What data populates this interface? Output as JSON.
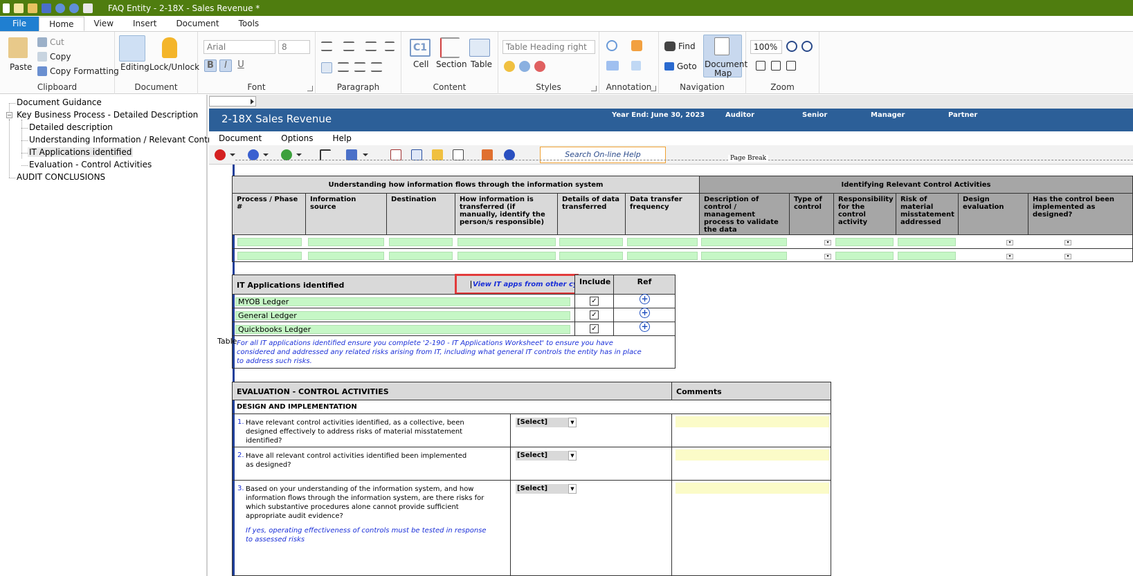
{
  "window": {
    "title": "FAQ Entity - 2-18X - Sales Revenue *"
  },
  "menu": {
    "file": "File",
    "tabs": [
      "Home",
      "View",
      "Insert",
      "Document",
      "Tools"
    ]
  },
  "ribbon": {
    "clipboard": {
      "paste": "Paste",
      "cut": "Cut",
      "copy": "Copy",
      "copy_formatting": "Copy Formatting",
      "label": "Clipboard"
    },
    "document": {
      "editing": "Editing",
      "lock": "Lock/Unlock",
      "label": "Document"
    },
    "font": {
      "name": "Arial",
      "size": "8",
      "label": "Font"
    },
    "paragraph": {
      "label": "Paragraph"
    },
    "content": {
      "cell": "Cell",
      "section": "Section",
      "table": "Table",
      "label": "Content"
    },
    "styles": {
      "current": "Table Heading right",
      "label": "Styles"
    },
    "annotation": {
      "label": "Annotation"
    },
    "navigation": {
      "find": "Find",
      "goto": "Goto",
      "docmap_line1": "Document",
      "docmap_line2": "Map",
      "label": "Navigation"
    },
    "zoom": {
      "level": "100%",
      "label": "Zoom"
    }
  },
  "tree": {
    "items": [
      "Document Guidance",
      "Key Business Process - Detailed Description",
      "Detailed description",
      "Understanding Information / Relevant Control A",
      "IT Applications identified",
      "Evaluation - Control Activities",
      "AUDIT CONCLUSIONS"
    ]
  },
  "doc": {
    "title": "2-18X Sales Revenue",
    "year_end": "Year End: June 30, 2023",
    "auditor": "Auditor",
    "senior": "Senior",
    "manager": "Manager",
    "partner": "Partner",
    "menu": [
      "Document",
      "Options",
      "Help"
    ],
    "search": "Search On-line Help",
    "page_break": "Page Break",
    "table_label": "Table"
  },
  "flows": {
    "left_title": "Understanding how information flows through the information system",
    "right_title": "Identifying Relevant Control Activities",
    "cols": [
      "Process / Phase #",
      "Information source",
      "Destination",
      "How information is transferred (if manually, identify the person/s responsible)",
      "Details of data transferred",
      "Data transfer frequency",
      "Description of control / management process to validate the data",
      "Type of control",
      "Responsibility for the control activity",
      "Risk of material misstatement addressed",
      "Design evaluation",
      "Has the control been implemented as designed?"
    ]
  },
  "itapps": {
    "header": "IT Applications identified",
    "link": "View IT apps from other cycles",
    "include": "Include",
    "ref": "Ref",
    "apps": [
      "MYOB Ledger",
      "General Ledger",
      "Quickbooks Ledger"
    ],
    "note": "For all IT applications identified ensure you complete '2-190 - IT Applications Worksheet' to ensure you have considered and addressed any related risks arising from IT, including what general IT controls the entity has in place to address such risks."
  },
  "evaluation": {
    "header": "EVALUATION - CONTROL ACTIVITIES",
    "comments": "Comments",
    "section": "DESIGN AND IMPLEMENTATION",
    "select": "[Select]",
    "q1_num": "1.",
    "q1": "Have relevant control activities identified, as a collective, been designed effectively to address risks of material misstatement identified?",
    "q2_num": "2.",
    "q2": "Have all relevant control activities identified been implemented as designed?",
    "q3_num": "3.",
    "q3": "Based on your understanding of the information system, and how information flows through the information system, are there risks for which substantive procedures alone cannot provide sufficient appropriate audit evidence?",
    "q3_note": "If yes, operating effectiveness of controls must be tested in response to assessed risks"
  }
}
